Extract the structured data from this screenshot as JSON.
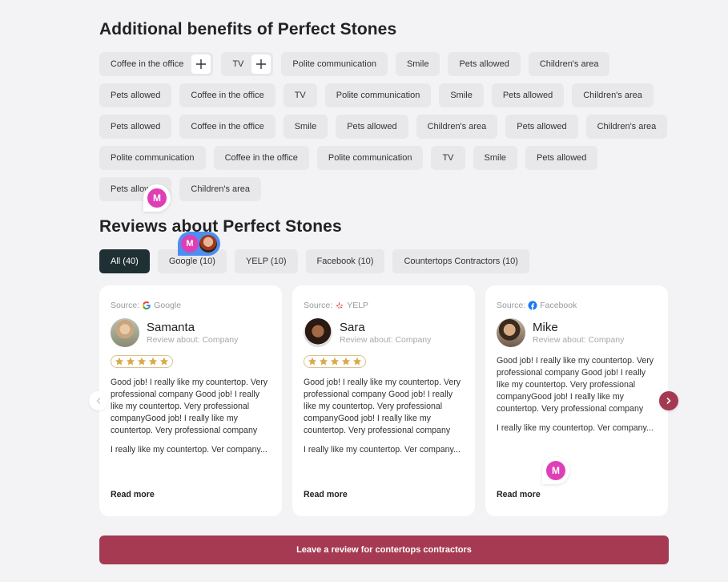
{
  "benefits": {
    "title": "Additional benefits of Perfect Stones",
    "tags": [
      {
        "label": "Coffee in the office",
        "addable": true
      },
      {
        "label": "TV",
        "addable": true
      },
      {
        "label": "Polite communication"
      },
      {
        "label": "Smile"
      },
      {
        "label": "Pets allowed"
      },
      {
        "label": "Children's area"
      },
      {
        "label": "Pets allowed"
      },
      {
        "label": "Coffee in the office"
      },
      {
        "label": "TV"
      },
      {
        "label": "Polite communication"
      },
      {
        "label": "Smile"
      },
      {
        "label": "Pets allowed"
      },
      {
        "label": "Children's area"
      },
      {
        "label": "Pets allowed"
      },
      {
        "label": "Coffee in the office"
      },
      {
        "label": "Smile"
      },
      {
        "label": "Pets allowed"
      },
      {
        "label": "Children's area"
      },
      {
        "label": "Pets allowed"
      },
      {
        "label": "Children's area"
      },
      {
        "label": "Polite communication"
      },
      {
        "label": "Coffee in the office"
      },
      {
        "label": "Polite communication"
      },
      {
        "label": "TV"
      },
      {
        "label": "Smile"
      },
      {
        "label": "Pets allowed"
      },
      {
        "label": "Pets allowed"
      },
      {
        "label": "Children's area"
      }
    ]
  },
  "reviews": {
    "title": "Reviews about Perfect Stones",
    "filters": [
      {
        "label": "All (40)",
        "active": true
      },
      {
        "label": "Google (10)"
      },
      {
        "label": "YELP (10)"
      },
      {
        "label": "Facebook (10)"
      },
      {
        "label": "Countertops Contractors (10)"
      }
    ],
    "source_prefix": "Source:",
    "cards": [
      {
        "source": "Google",
        "source_icon": "google-icon",
        "name": "Samanta",
        "about": "Review about: Company",
        "rating": 5,
        "text": "Good job! I really like my countertop. Very professional company Good job! I really like my countertop. Very professional companyGood job! I really like my countertop. Very professional company",
        "text2": "I really like my countertop. Ver company...",
        "read_more": "Read more"
      },
      {
        "source": "YELP",
        "source_icon": "yelp-icon",
        "name": "Sara",
        "about": "Review about: Company",
        "rating": 5,
        "text": "Good job! I really like my countertop. Very professional company Good job! I really like my countertop. Very professional companyGood job! I really like my countertop. Very professional company",
        "text2": "I really like my countertop. Ver company...",
        "read_more": "Read more"
      },
      {
        "source": "Facebook",
        "source_icon": "facebook-icon",
        "name": "Mike",
        "about": "Review about: Company",
        "rating": null,
        "text": "Good job! I really like my countertop. Very professional company Good job! I really like my countertop. Very professional companyGood job! I really like my countertop. Very professional company",
        "text2": "I really like my countertop. Ver company...",
        "read_more": "Read more"
      }
    ]
  },
  "cta": {
    "label": "Leave a review for contertops contractors"
  },
  "collaborators": {
    "initial": "M"
  },
  "colors": {
    "accent": "#a63a52",
    "active_filter": "#1f3035",
    "cursor": "#de3fb6",
    "star": "#d9a94a"
  }
}
